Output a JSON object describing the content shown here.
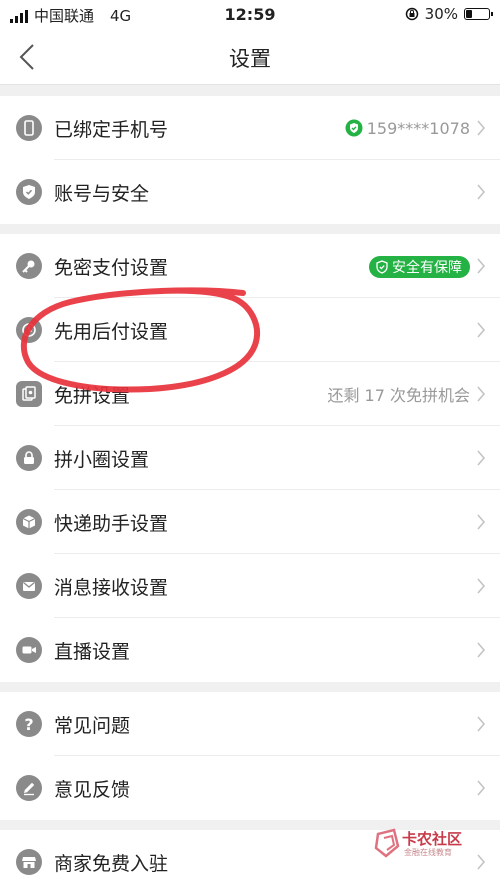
{
  "status_bar": {
    "carrier": "中国联通",
    "network": "4G",
    "time": "12:59",
    "battery": "30%",
    "battery_level": 0.3
  },
  "nav": {
    "title": "设置"
  },
  "groups": [
    {
      "items": [
        {
          "label": "已绑定手机号",
          "extra": "159****1078",
          "icon": "phone-icon"
        },
        {
          "label": "账号与安全",
          "icon": "shield-icon"
        }
      ]
    },
    {
      "items": [
        {
          "label": "免密支付设置",
          "badge": "安全有保障",
          "icon": "key-icon"
        },
        {
          "label": "先用后付设置",
          "icon": "clock-pay-icon"
        },
        {
          "label": "免拼设置",
          "extra": "还剩 17 次免拼机会",
          "icon": "group-buy-icon"
        },
        {
          "label": "拼小圈设置",
          "icon": "lock-circle-icon"
        },
        {
          "label": "快递助手设置",
          "icon": "package-icon"
        },
        {
          "label": "消息接收设置",
          "icon": "mail-icon"
        },
        {
          "label": "直播设置",
          "icon": "video-icon"
        }
      ]
    },
    {
      "items": [
        {
          "label": "常见问题",
          "icon": "question-icon"
        },
        {
          "label": "意见反馈",
          "icon": "edit-icon"
        }
      ]
    },
    {
      "items": [
        {
          "label": "商家免费入驻",
          "icon": "store-icon"
        }
      ]
    }
  ],
  "watermark": {
    "name": "卡农社区",
    "sub": "金融在线教育"
  },
  "colors": {
    "accent_green": "#23b243",
    "icon_gray": "#8a8a8a",
    "annotation_red": "#e8323c"
  }
}
